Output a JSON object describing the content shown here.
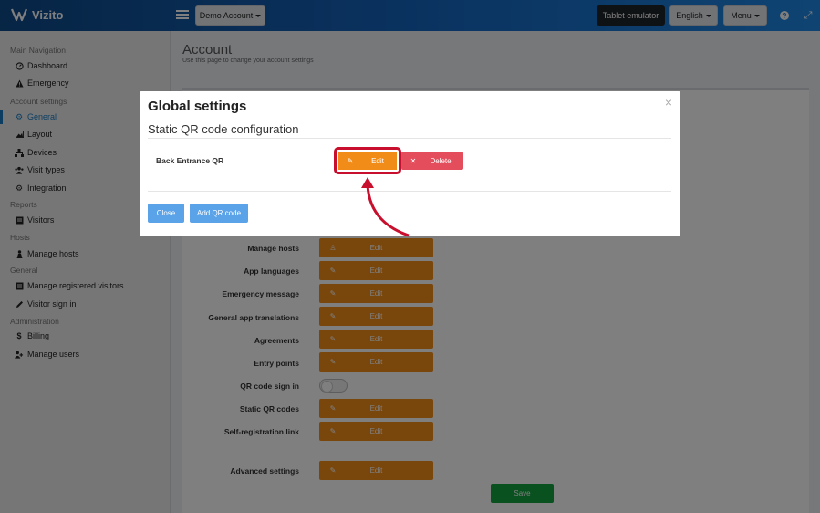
{
  "app": {
    "name": "Vizito"
  },
  "topbar": {
    "account_button": "Demo Account",
    "tablet_button": "Tablet emulator",
    "language_button": "English",
    "menu_button": "Menu",
    "help_icon": "?",
    "expand_icon": "⤢"
  },
  "sidebar": {
    "sections": [
      {
        "header": "Main Navigation",
        "items": [
          {
            "label": "Dashboard",
            "icon": "dashboard-icon"
          },
          {
            "label": "Emergency",
            "icon": "warning-icon"
          }
        ]
      },
      {
        "header": "Account settings",
        "items": [
          {
            "label": "General",
            "icon": "gear-icon",
            "active": true
          },
          {
            "label": "Layout",
            "icon": "image-icon"
          },
          {
            "label": "Devices",
            "icon": "sitemap-icon"
          },
          {
            "label": "Visit types",
            "icon": "users-icon"
          },
          {
            "label": "Integration",
            "icon": "gear-icon"
          }
        ]
      },
      {
        "header": "Reports",
        "items": [
          {
            "label": "Visitors",
            "icon": "list-icon"
          }
        ]
      },
      {
        "header": "Hosts",
        "items": [
          {
            "label": "Manage hosts",
            "icon": "person-icon"
          }
        ]
      },
      {
        "header": "General",
        "items": [
          {
            "label": "Manage registered visitors",
            "icon": "list-icon"
          },
          {
            "label": "Visitor sign in",
            "icon": "pencil-icon"
          }
        ]
      },
      {
        "header": "Administration",
        "items": [
          {
            "label": "Billing",
            "icon": "dollar-icon"
          },
          {
            "label": "Manage users",
            "icon": "user-plus-icon"
          }
        ]
      }
    ]
  },
  "page": {
    "title": "Account",
    "subtitle": "Use this page to change your account settings",
    "rows": [
      {
        "label": "Manage hosts",
        "button": "Edit",
        "icon": "person-icon"
      },
      {
        "label": "App languages",
        "button": "Edit",
        "icon": "edit-icon"
      },
      {
        "label": "Emergency message",
        "button": "Edit",
        "icon": "edit-icon"
      },
      {
        "label": "General app translations",
        "button": "Edit",
        "icon": "edit-icon"
      },
      {
        "label": "Agreements",
        "button": "Edit",
        "icon": "edit-icon"
      },
      {
        "label": "Entry points",
        "button": "Edit",
        "icon": "edit-icon"
      },
      {
        "label": "QR code sign in",
        "toggle": false
      },
      {
        "label": "Static QR codes",
        "button": "Edit",
        "icon": "edit-icon"
      },
      {
        "label": "Self-registration link",
        "button": "Edit",
        "icon": "edit-icon"
      },
      {
        "label": "Advanced settings",
        "button": "Edit",
        "icon": "edit-icon"
      }
    ],
    "save_button": "Save"
  },
  "modal": {
    "title": "Global settings",
    "close_icon": "×",
    "subtitle": "Static QR code configuration",
    "qr_item": {
      "label": "Back Entrance QR",
      "edit": "Edit",
      "delete": "Delete"
    },
    "close_button": "Close",
    "add_button": "Add QR code"
  },
  "colors": {
    "accent": "#1a7dc2",
    "orange": "#f28c18",
    "danger": "#e44d5b",
    "primary_light": "#5ba3e8",
    "success": "#13a23e",
    "highlight": "#c8102e"
  }
}
